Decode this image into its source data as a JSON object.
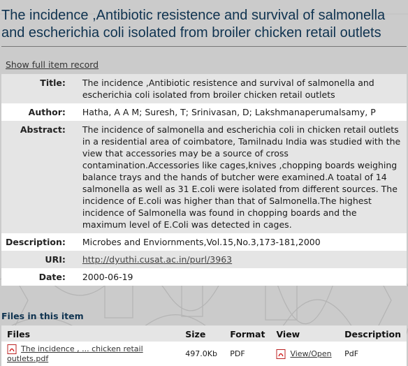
{
  "page": {
    "title": "The incidence ,Antibiotic resistence and survival of salmonella and escherichia coli isolated from broiler chicken retail outlets",
    "show_full_record": "Show full item record"
  },
  "metadata": [
    {
      "label": "Title:",
      "value": "The incidence ,Antibiotic resistence and survival of salmonella and escherichia coli isolated from broiler chicken retail outlets"
    },
    {
      "label": "Author:",
      "value": "Hatha, A A M; Suresh, T; Srinivasan, D; Lakshmanaperumalsamy, P"
    },
    {
      "label": "Abstract:",
      "value": "The incidence of salmonella and escherichia coli in chicken retail outlets in a residential area of coimbatore, Tamilnadu India was studied with the view that accessories may be a source of cross contamination.Accessories like cages,knives ,chopping boards weighing balance trays and the hands of butcher were examined.A toatal of 14 salmonella as well as 31 E.coli were isolated from different sources. The incidence of E.coli was higher than that of Salmonella.The highest incidence of Salmonella was found in chopping boards and the maximum level of E.Coli was detected in cages."
    },
    {
      "label": "Description:",
      "value": "Microbes and Enviornments,Vol.15,No.3,173-181,2000"
    },
    {
      "label": "URI:",
      "value": "http://dyuthi.cusat.ac.in/purl/3963"
    },
    {
      "label": "Date:",
      "value": "2000-06-19"
    }
  ],
  "files": {
    "heading": "Files in this item",
    "columns": [
      "Files",
      "Size",
      "Format",
      "View",
      "Description"
    ],
    "rows": [
      {
        "name": "The incidence , ... chicken retail outlets.pdf",
        "size": "497.0Kb",
        "format": "PDF",
        "view": "View/Open",
        "description": "PdF"
      }
    ]
  },
  "icons": {
    "file": "pdf-icon",
    "view": "pdf-icon"
  },
  "colors": {
    "title": "#0f3350",
    "background": "#cbcbcb",
    "row_alt": "#e5e5e5"
  }
}
